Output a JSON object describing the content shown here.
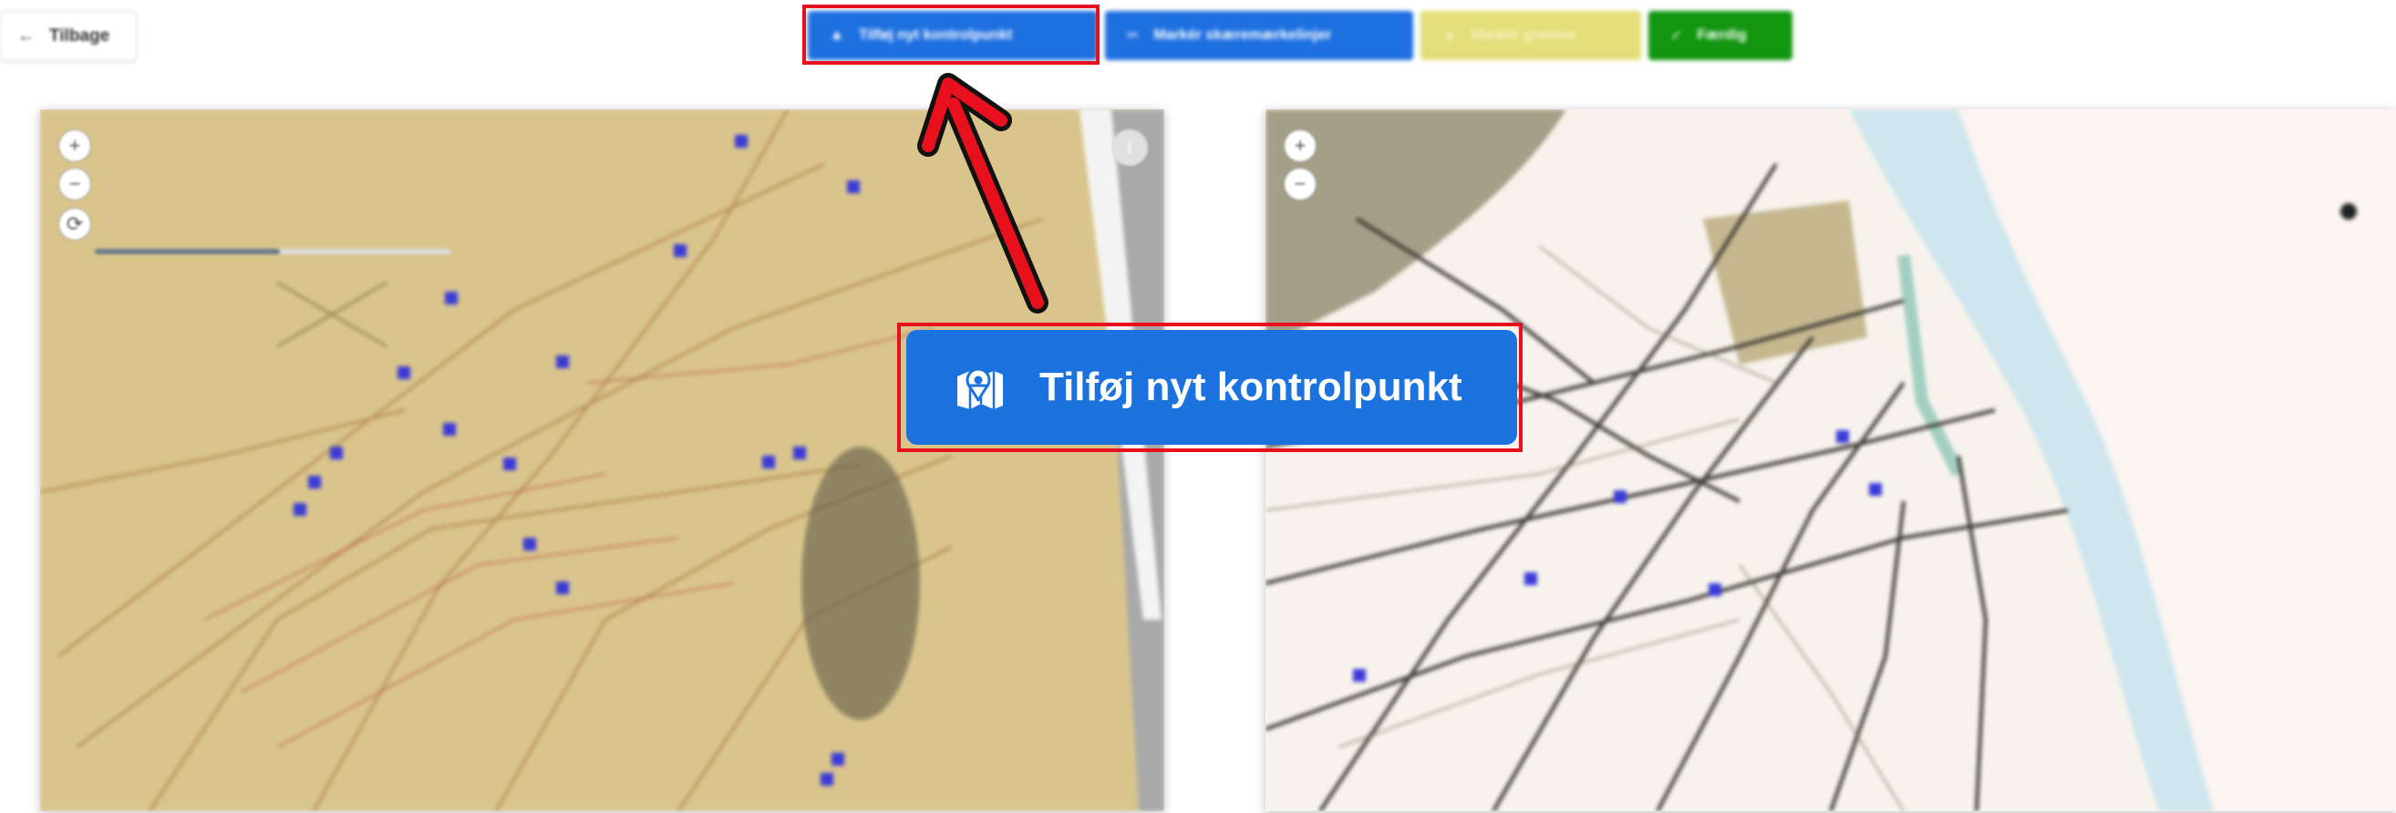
{
  "header": {
    "back_label": "Tilbage"
  },
  "toolbar": {
    "buttons": [
      {
        "label": "Tilføj nyt kontrolpunkt",
        "color": "#1e6fe0",
        "icon": "map-marker-icon"
      },
      {
        "label": "Markér skæremærkelinjer",
        "color": "#1e6fe0",
        "icon": "crop-icon"
      },
      {
        "label": "Markér grænse",
        "color": "#e2df7a",
        "icon": "boundary-icon"
      },
      {
        "label": "Færdig",
        "color": "#12950f",
        "icon": "check-icon"
      }
    ]
  },
  "callout": {
    "label": "Tilføj nyt kontrolpunkt",
    "icon": "map-marker-icon",
    "highlight_color": "#e8101c"
  },
  "left_map": {
    "zoom_in": "+",
    "zoom_out": "−",
    "reset": "⟳",
    "opacity": 0.52,
    "info": "i"
  },
  "right_map": {
    "zoom_in": "+",
    "zoom_out": "−"
  }
}
